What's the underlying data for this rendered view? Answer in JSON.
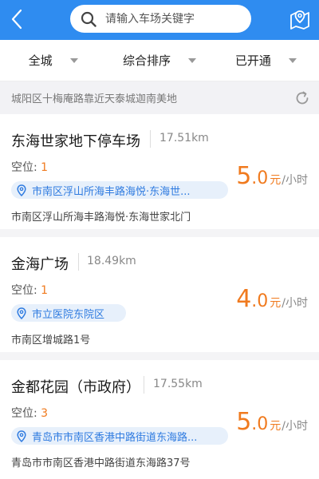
{
  "header": {
    "search_placeholder": "请输入车场关键字",
    "accent_color": "#2f8cf0"
  },
  "filters": [
    {
      "label": "全城"
    },
    {
      "label": "综合排序"
    },
    {
      "label": "已开通"
    }
  ],
  "location": {
    "text": "城阳区十梅庵路靠近天泰城迦南美地"
  },
  "parkings": [
    {
      "name": "东海世家地下停车场",
      "distance": "17.51km",
      "spaces_label": "空位:",
      "spaces_value": "1",
      "tag": "市南区浮山所海丰路海悦·东海世...",
      "address": "市南区浮山所海丰路海悦·东海世家北门",
      "price_integer": "5",
      "price_decimal": ".0",
      "price_unit": "元",
      "price_period": "/小时"
    },
    {
      "name": "金海广场",
      "distance": "18.49km",
      "spaces_label": "空位:",
      "spaces_value": "1",
      "tag": "市立医院东院区",
      "address": "市南区增城路1号",
      "price_integer": "4",
      "price_decimal": ".0",
      "price_unit": "元",
      "price_period": "/小时"
    },
    {
      "name": "金都花园（市政府）",
      "distance": "17.55km",
      "spaces_label": "空位:",
      "spaces_value": "3",
      "tag": "青岛市市南区香港中路街道东海路...",
      "address": "青岛市市南区香港中路街道东海路37号",
      "price_integer": "5",
      "price_decimal": ".0",
      "price_unit": "元",
      "price_period": "/小时"
    }
  ]
}
